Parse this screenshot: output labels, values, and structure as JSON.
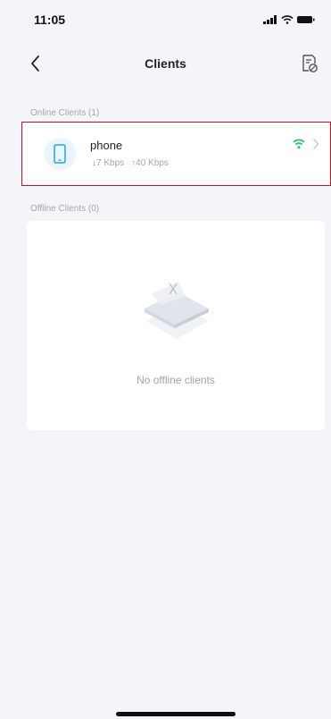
{
  "status_bar": {
    "time": "11:05"
  },
  "nav": {
    "title": "Clients"
  },
  "online": {
    "label": "Online Clients (1)",
    "clients": [
      {
        "name": "phone",
        "down_rate": "7 Kbps",
        "up_rate": "40 Kbps",
        "icon": "phone-icon",
        "connection": "wifi-icon"
      }
    ]
  },
  "offline": {
    "label": "Offline Clients (0)",
    "empty_text": "No offline clients"
  },
  "colors": {
    "background": "#f4f5f9",
    "highlight_border": "#c8102e",
    "download": "#3dbd72",
    "upload": "#f0a83a",
    "wifi": "#22c55e",
    "avatar_bg": "#eaf5fc"
  }
}
